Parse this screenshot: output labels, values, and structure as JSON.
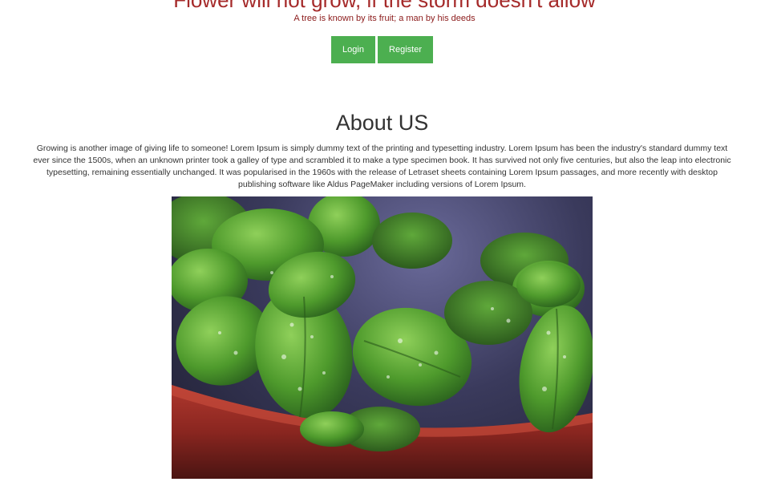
{
  "hero": {
    "title": "Flower will not grow, if the storm doesn't allow",
    "subtitle": "A tree is known by its fruit; a man by his deeds"
  },
  "auth": {
    "login_label": "Login",
    "register_label": "Register"
  },
  "about": {
    "heading": "About US",
    "body": "Growing is another image of giving life to someone! Lorem Ipsum is simply dummy text of the printing and typesetting industry. Lorem Ipsum has been the industry's standard dummy text ever since the 1500s, when an unknown printer took a galley of type and scrambled it to make a type specimen book. It has survived not only five centuries, but also the leap into electronic typesetting, remaining essentially unchanged. It was popularised in the 1960s with the release of Letraset sheets containing Lorem Ipsum passages, and more recently with desktop publishing software like Aldus PageMaker including versions of Lorem Ipsum.",
    "image_subject": "potted basil plant with water droplets"
  },
  "colors": {
    "button_green": "#4caf50",
    "title_red": "#a52a2a",
    "text_dark": "#333333"
  }
}
